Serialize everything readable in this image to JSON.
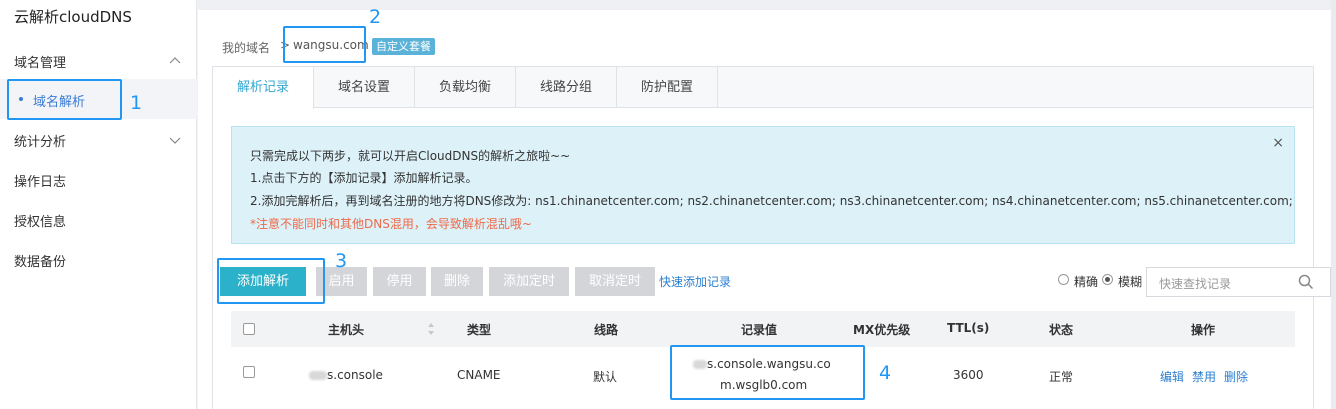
{
  "sidebar": {
    "brand": "云解析cloudDNS",
    "groups": [
      {
        "label": "域名管理",
        "expanded": true
      },
      {
        "label": "统计分析",
        "expanded": false
      }
    ],
    "active_item": "域名解析",
    "items": [
      "操作日志",
      "授权信息",
      "数据备份"
    ]
  },
  "breadcrumb": {
    "root": "我的域名",
    "separator": ">",
    "domain": "wangsu.com",
    "badge": "自定义套餐"
  },
  "tabs": [
    "解析记录",
    "域名设置",
    "负载均衡",
    "线路分组",
    "防护配置"
  ],
  "active_tab": 0,
  "notice": {
    "line1": "只需完成以下两步，就可以开启CloudDNS的解析之旅啦~~",
    "line2": "1.点击下方的【添加记录】添加解析记录。",
    "line3": "2.添加完解析后，再到域名注册的地方将DNS修改为: ns1.chinanetcenter.com; ns2.chinanetcenter.com; ns3.chinanetcenter.com; ns4.chinanetcenter.com; ns5.chinanetcenter.com;",
    "warning": "*注意不能同时和其他DNS混用，会导致解析混乱哦~",
    "close": "×"
  },
  "toolbar": {
    "add": "添加解析",
    "enable": "启用",
    "disable": "停用",
    "delete": "删除",
    "add_timer": "添加定时",
    "cancel_timer": "取消定时",
    "quick_add": "快速添加记录",
    "mode_exact": "精确",
    "mode_fuzzy": "模糊",
    "mode_selected": "模糊",
    "search_placeholder": "快速查找记录"
  },
  "table": {
    "columns": [
      "主机头",
      "类型",
      "线路",
      "记录值",
      "MX优先级",
      "TTL(s)",
      "状态",
      "操作"
    ],
    "rows": [
      {
        "host": "s.console",
        "type": "CNAME",
        "line": "默认",
        "value_line1": "s.console.wangsu.co",
        "value_line2": "m.wsglb0.com",
        "mx": "",
        "ttl": "3600",
        "status": "正常",
        "actions": [
          "编辑",
          "禁用",
          "删除"
        ]
      }
    ]
  },
  "annotations": [
    "1",
    "2",
    "3",
    "4"
  ],
  "colors": {
    "accent": "#2bb1c9",
    "link": "#2b7fd0",
    "annotation": "#2196f3",
    "warning": "#ee6a4a",
    "notice_bg": "#dcf1f8"
  }
}
